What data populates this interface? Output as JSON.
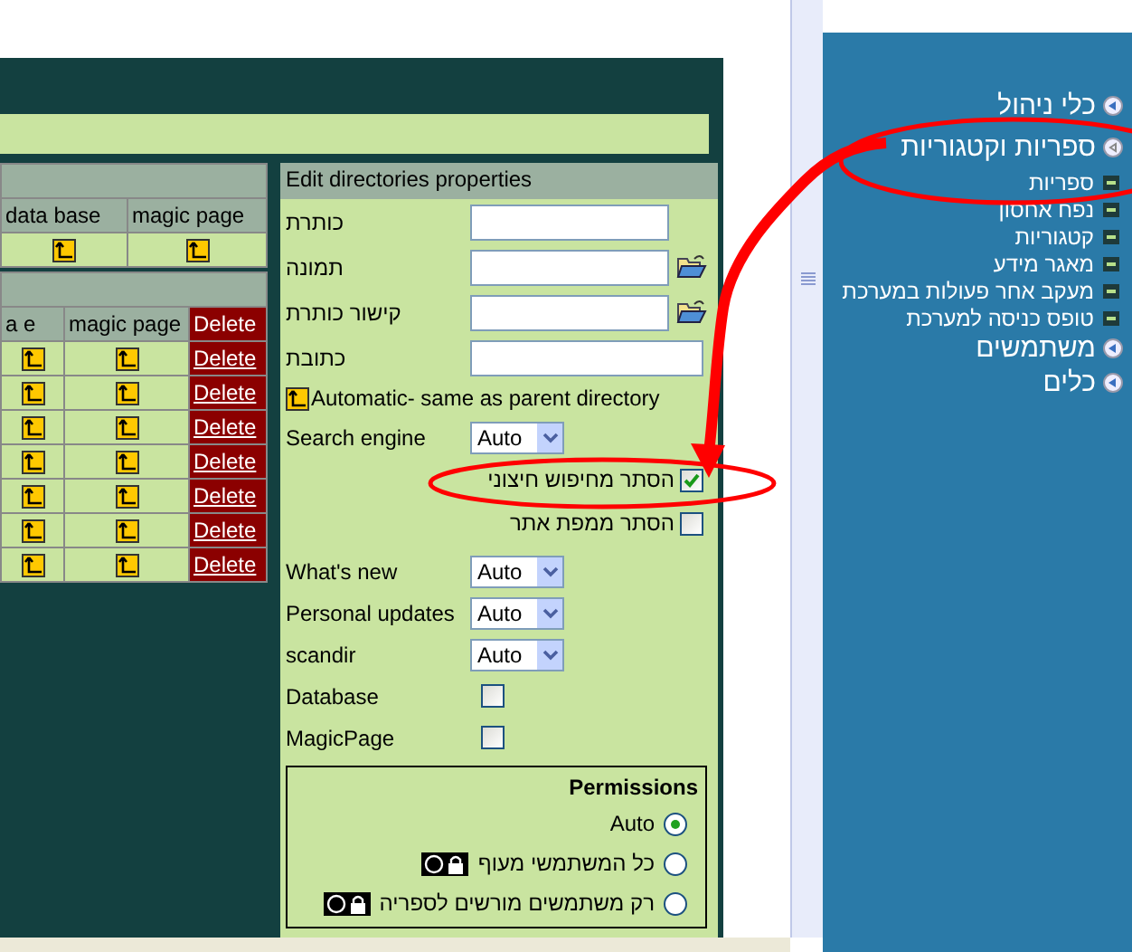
{
  "top_table": {
    "columns": [
      "magic page",
      "data base"
    ],
    "row": [
      {
        "kind": "icon"
      },
      {
        "kind": "icon"
      }
    ]
  },
  "dir_table": {
    "columns": [
      "Delete",
      "magic page",
      "a e"
    ],
    "rows": [
      {
        "link": "Delete"
      },
      {
        "link": "Delete"
      },
      {
        "link": "Delete"
      },
      {
        "link": "Delete"
      },
      {
        "link": "Delete"
      },
      {
        "link": "Delete"
      },
      {
        "link": "Delete"
      }
    ]
  },
  "form": {
    "title": "Edit directories properties",
    "fields": [
      {
        "kind": "text",
        "label": "כותרת",
        "browse": false
      },
      {
        "kind": "text",
        "label": "תמונה",
        "browse": true
      },
      {
        "kind": "text",
        "label": "קישור כותרת",
        "browse": true
      },
      {
        "kind": "text",
        "label": "כתובת",
        "browse": false
      }
    ],
    "auto_note": "Automatic- same as parent directory",
    "search_engine": {
      "label": "Search engine",
      "value": "Auto"
    },
    "hide_options": [
      {
        "label": "הסתר מחיפוש חיצוני",
        "checked": true
      },
      {
        "label": "הסתר ממפת אתר",
        "checked": false
      }
    ],
    "selects": [
      {
        "label": "What's new",
        "value": "Auto"
      },
      {
        "label": "Personal updates",
        "value": "Auto"
      },
      {
        "label": "scandir",
        "value": "Auto"
      }
    ],
    "checks": [
      {
        "label": "Database",
        "checked": false
      },
      {
        "label": "MagicPage",
        "checked": false
      }
    ],
    "permissions": {
      "title": "Permissions",
      "options": [
        {
          "label": "Auto",
          "icon": false,
          "selected": true
        },
        {
          "label": "כל המשתמשי מעוף",
          "icon": true,
          "selected": false
        },
        {
          "label": "רק משתמשים מורשים לספריה",
          "icon": true,
          "selected": false
        }
      ]
    }
  },
  "sidebar": [
    {
      "label": "כלי ניהול",
      "expanded": false
    },
    {
      "label": "ספריות וקטגוריות",
      "expanded": true,
      "children": [
        {
          "label": "ספריות"
        },
        {
          "label": "נפח אחסון"
        },
        {
          "label": "קטגוריות"
        },
        {
          "label": "מאגר מידע"
        },
        {
          "label": "מעקב אחר פעולות במערכת"
        },
        {
          "label": "טופס כניסה למערכת"
        }
      ]
    },
    {
      "label": "משתמשים",
      "expanded": false
    },
    {
      "label": "כלים",
      "expanded": false
    }
  ]
}
